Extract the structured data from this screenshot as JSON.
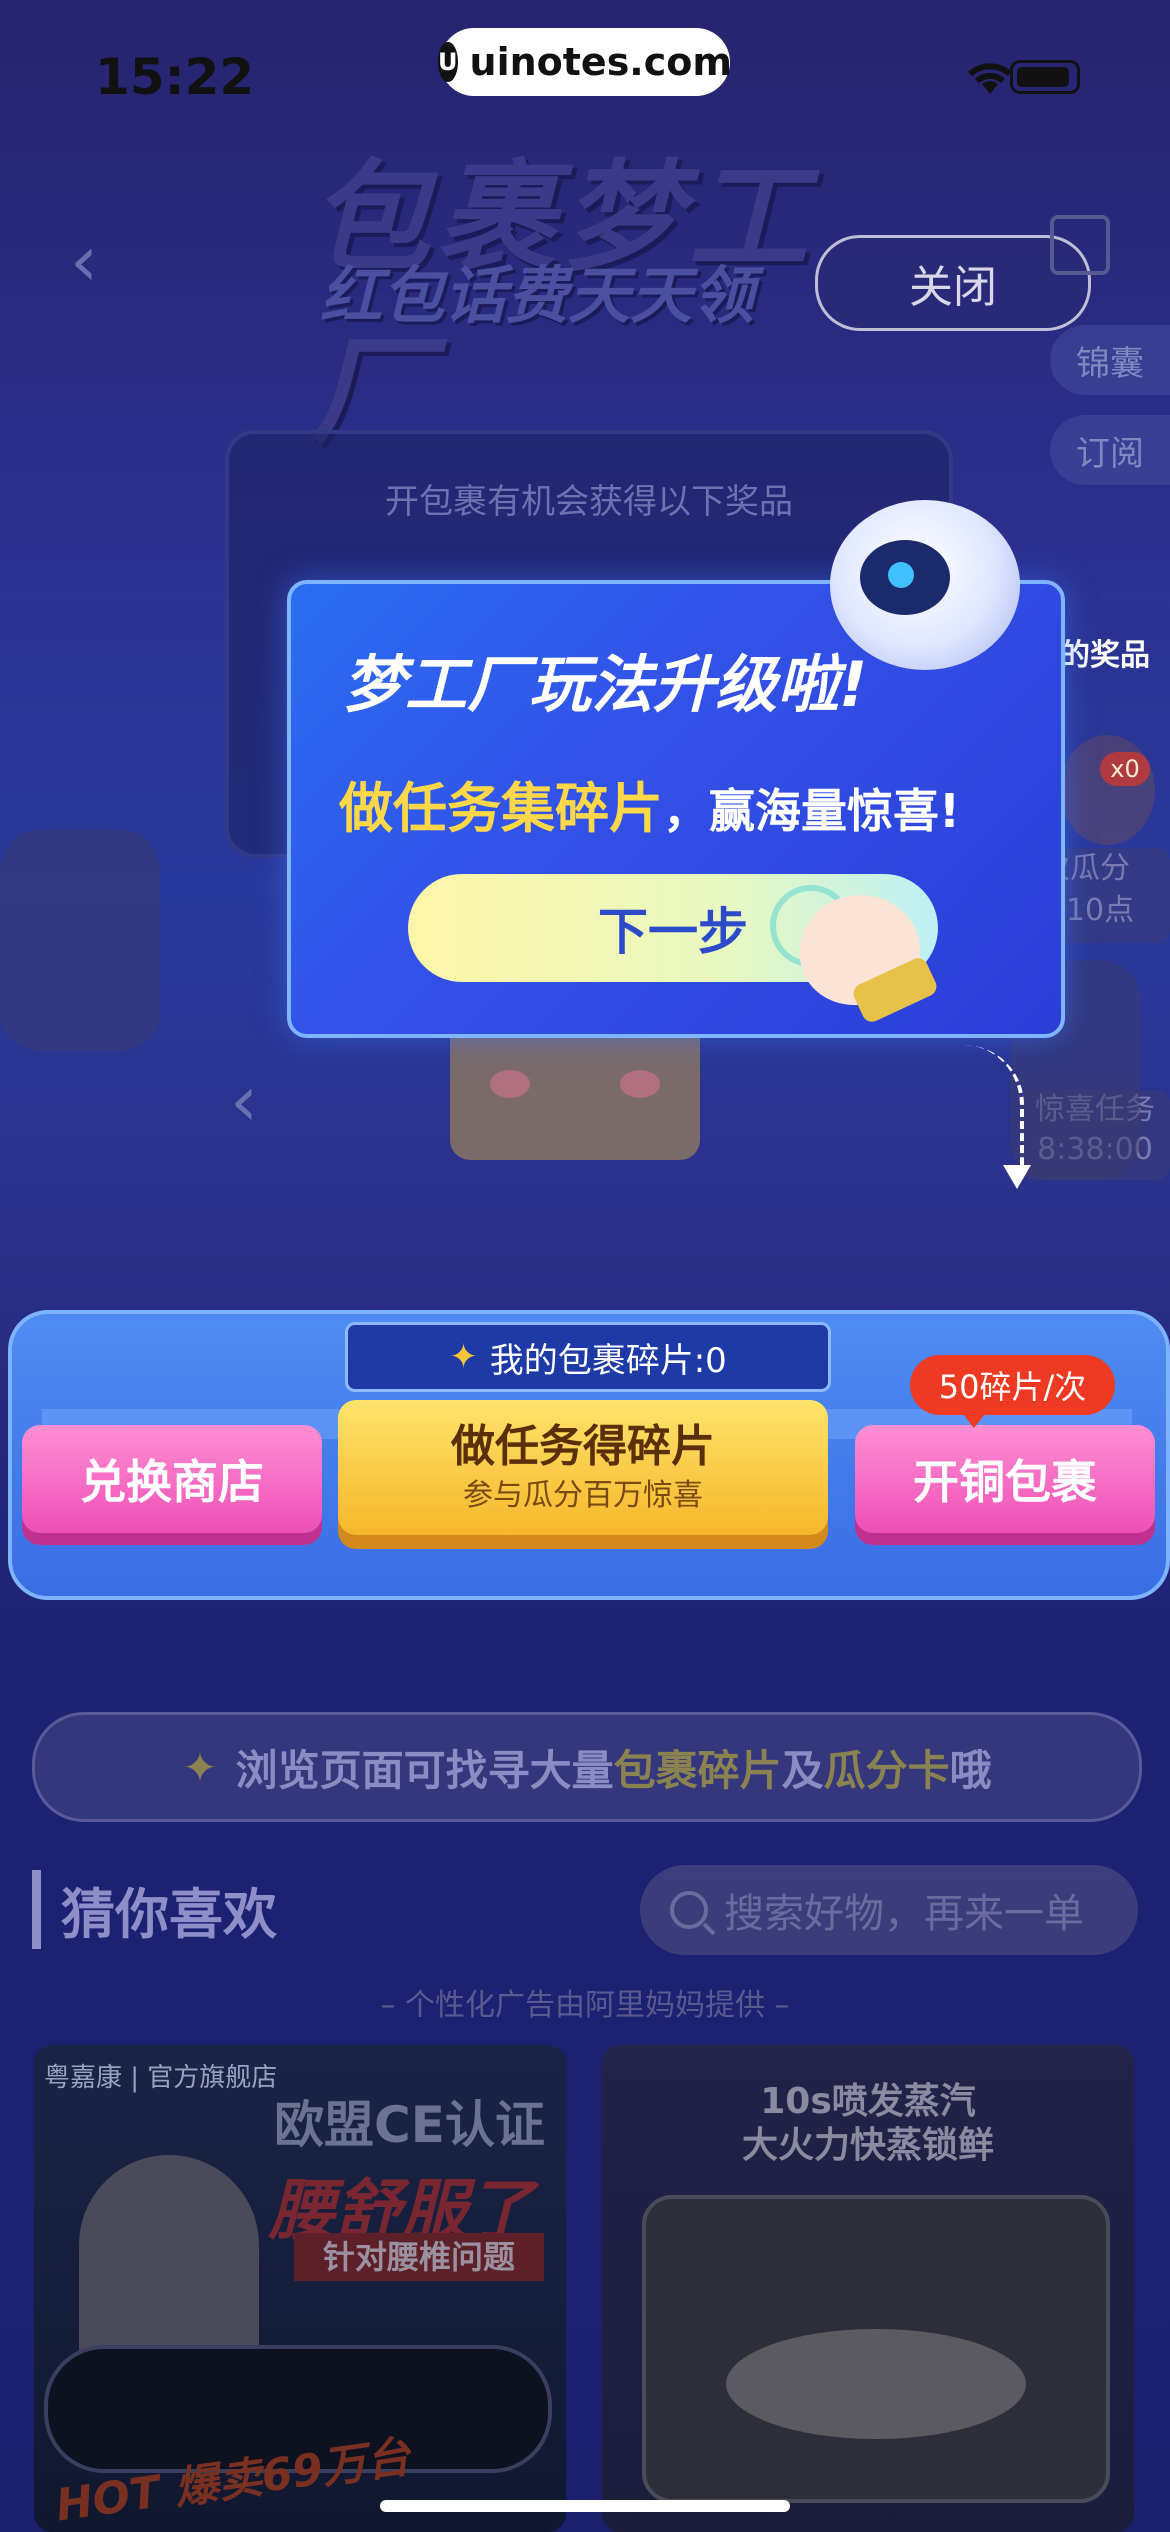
{
  "status_bar": {
    "time": "15:22",
    "url": "uinotes.com",
    "logo_letter": "U"
  },
  "header": {
    "title_line1": "包裹梦工厂",
    "title_line2": "红包话费天天领",
    "close_label": "关闭",
    "side_tags": [
      "锦囊",
      "订阅"
    ]
  },
  "machine": {
    "prize_text": "开包裹有机会获得以下奖品",
    "side_prize_label": "的奖品",
    "side_count": "x0",
    "side_text1": "次瓜分",
    "side_text2": "早10点",
    "side_text3": "惊喜任务",
    "side_text4": "8:38:00"
  },
  "popup": {
    "title": "梦工厂玩法升级啦!",
    "highlight": "做任务集碎片",
    "rest": "，赢海量惊喜!",
    "next_label": "下一步"
  },
  "panel": {
    "shards_label": "我的包裹碎片:0",
    "exchange_label": "兑换商店",
    "task_label": "做任务得碎片",
    "task_sub": "参与瓜分百万惊喜",
    "open_label": "开铜包裹",
    "cost_badge": "50碎片/次"
  },
  "info_strip": {
    "part1": "浏览页面可找寻大量",
    "part2": "包裹碎片",
    "part3": "及",
    "part4": "瓜分卡",
    "part5": "哦"
  },
  "guess": {
    "title": "猜你喜欢",
    "search_placeholder": "搜索好物，再来一单",
    "ad_note": "– 个性化广告由阿里妈妈提供 –"
  },
  "products": [
    {
      "brand": "粤嘉康 | 官方旗舰店",
      "line1": "欧盟CE认证",
      "line2": "腰舒服了",
      "line3": "针对腰椎问题",
      "hot": "HOT 爆卖69万台"
    },
    {
      "line1": "10s喷发蒸汽",
      "line2": "大火力快蒸锁鲜"
    }
  ]
}
